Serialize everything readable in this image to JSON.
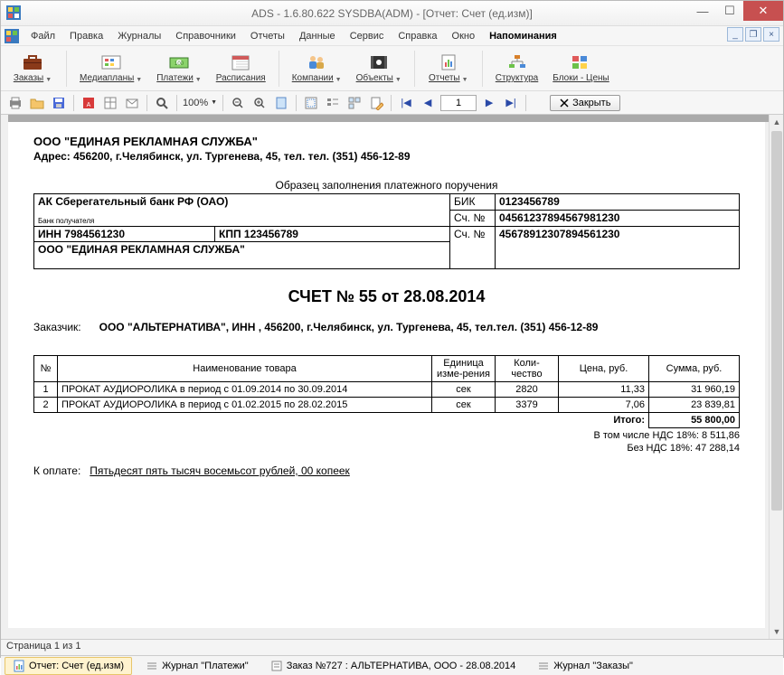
{
  "window": {
    "title": "ADS - 1.6.80.622 SYSDBA(ADM) - [Отчет: Счет (ед.изм)]"
  },
  "menu": {
    "file": "Файл",
    "edit": "Правка",
    "journals": "Журналы",
    "ref": "Справочники",
    "reports": "Отчеты",
    "data": "Данные",
    "service": "Сервис",
    "help": "Справка",
    "window": "Окно",
    "reminders": "Напоминания"
  },
  "toolbar": {
    "orders": "Заказы",
    "mediaplans": "Медиапланы",
    "payments": "Платежи",
    "schedules": "Расписания",
    "companies": "Компании",
    "objects": "Объекты",
    "reports": "Отчеты",
    "structure": "Структура",
    "blocks_prices": "Блоки - Цены"
  },
  "toolbar2": {
    "zoom": "100%",
    "page": "1",
    "close": "Закрыть"
  },
  "doc": {
    "org": "ООО \"ЕДИНАЯ РЕКЛАМНАЯ СЛУЖБА\"",
    "addr": "Адрес: 456200, г.Челябинск, ул. Тургенева, 45, тел. тел. (351) 456-12-89",
    "sample": "Образец заполнения платежного поручения",
    "bank": {
      "name": "АК Сберегательный банк РФ (ОАО)",
      "recipient_label": "Банк получателя",
      "bik_label": "БИК",
      "bik": "0123456789",
      "acc_label": "Сч. №",
      "acc": "04561237894567981230",
      "inn": "ИНН 7984561230",
      "kpp": "КПП 123456789",
      "acc2_label": "Сч. №",
      "acc2": "45678912307894561230",
      "org": "ООО \"ЕДИНАЯ РЕКЛАМНАЯ СЛУЖБА\""
    },
    "title": "СЧЕТ № 55 от 28.08.2014",
    "customer_label": "Заказчик:",
    "customer": "ООО \"АЛЬТЕРНАТИВА\", ИНН , 456200, г.Челябинск, ул. Тургенева, 45, тел.тел. (351) 456-12-89",
    "cols": {
      "num": "№",
      "name": "Наименование товара",
      "unit": "Единица изме-рения",
      "qty": "Коли-чество",
      "price": "Цена, руб.",
      "sum": "Сумма, руб."
    },
    "rows": [
      {
        "n": "1",
        "name": "ПРОКАТ АУДИОРОЛИКА в период с 01.09.2014 по 30.09.2014",
        "unit": "сек",
        "qty": "2820",
        "price": "11,33",
        "sum": "31 960,19"
      },
      {
        "n": "2",
        "name": "ПРОКАТ АУДИОРОЛИКА в период с 01.02.2015 по 28.02.2015",
        "unit": "сек",
        "qty": "3379",
        "price": "7,06",
        "sum": "23 839,81"
      }
    ],
    "itogo_label": "Итого:",
    "itogo": "55 800,00",
    "vat_incl": "В том числе НДС 18%: 8 511,86",
    "vat_excl": "Без НДС 18%: 47 288,14",
    "pay_label": "К оплате:",
    "pay_words": "Пятьдесят пять тысяч восемьсот рублей, 00 копеек"
  },
  "status": "Страница 1 из 1",
  "tabs": [
    {
      "label": "Отчет: Счет (ед.изм)",
      "active": true
    },
    {
      "label": "Журнал \"Платежи\"",
      "active": false
    },
    {
      "label": "Заказ №727 : АЛЬТЕРНАТИВА, ООО - 28.08.2014",
      "active": false
    },
    {
      "label": "Журнал \"Заказы\"",
      "active": false
    }
  ]
}
